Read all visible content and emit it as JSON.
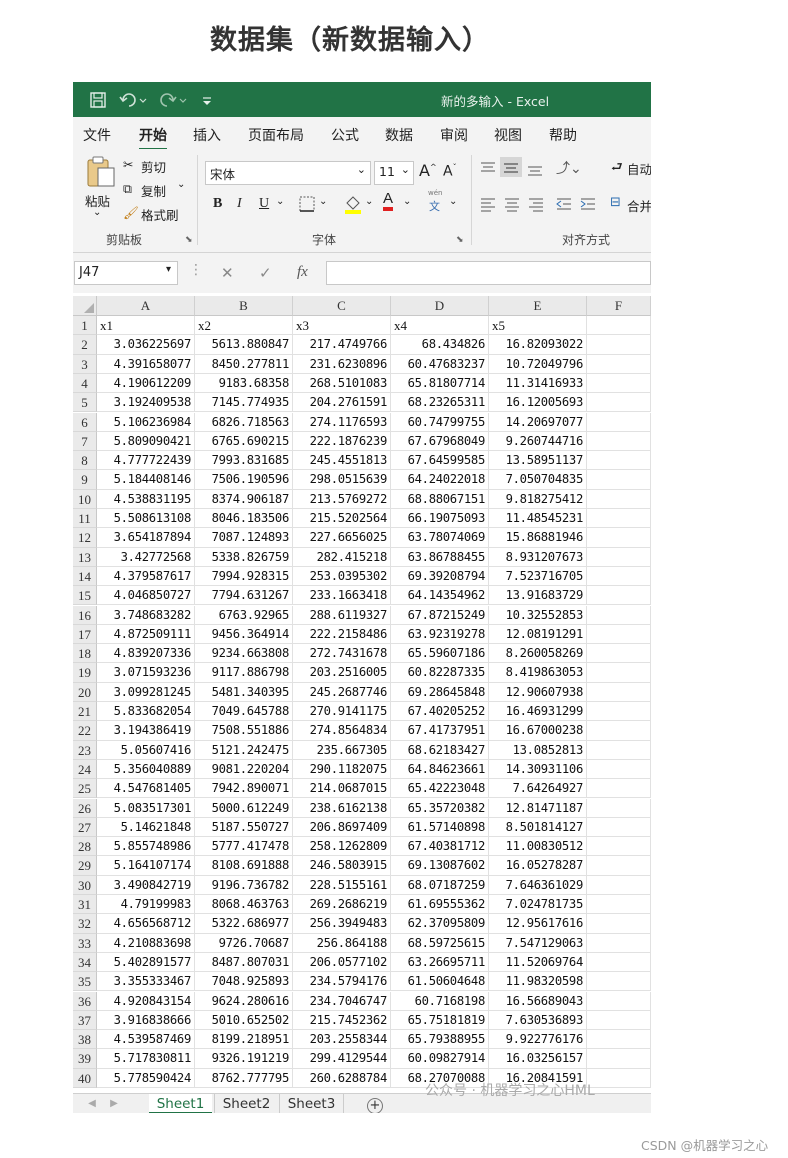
{
  "page_title": "数据集（新数据输入）",
  "window": {
    "title": "新的多输入 - Excel",
    "quick_access_icons": [
      "save-icon",
      "undo-icon",
      "redo-icon",
      "customize-icon"
    ]
  },
  "menu_tabs": [
    "文件",
    "开始",
    "插入",
    "页面布局",
    "公式",
    "数据",
    "审阅",
    "视图",
    "帮助"
  ],
  "ribbon": {
    "paste_label": "粘贴",
    "cut_label": "剪切",
    "copy_label": "复制",
    "format_painter_label": "格式刷",
    "clipboard_group": "剪贴板",
    "font_name": "宋体",
    "font_size": "11",
    "bold": "B",
    "italic": "I",
    "underline": "U",
    "font_color_letter": "A",
    "phonetic_small": "wén",
    "phonetic_big": "文",
    "font_group": "字体",
    "wrap_label": "自动",
    "merge_label": "合并",
    "alignment_group": "对齐方式"
  },
  "formula_bar": {
    "name_box": "J47",
    "fx_label": "fx",
    "formula": ""
  },
  "columns": [
    "A",
    "B",
    "C",
    "D",
    "E",
    "F"
  ],
  "headers": [
    "x1",
    "x2",
    "x3",
    "x4",
    "x5"
  ],
  "rows": [
    [
      "3.036225697",
      "5613.880847",
      "217.4749766",
      "68.434826",
      "16.82093022"
    ],
    [
      "4.391658077",
      "8450.277811",
      "231.6230896",
      "60.47683237",
      "10.72049796"
    ],
    [
      "4.190612209",
      "9183.68358",
      "268.5101083",
      "65.81807714",
      "11.31416933"
    ],
    [
      "3.192409538",
      "7145.774935",
      "204.2761591",
      "68.23265311",
      "16.12005693"
    ],
    [
      "5.106236984",
      "6826.718563",
      "274.1176593",
      "60.74799755",
      "14.20697077"
    ],
    [
      "5.809090421",
      "6765.690215",
      "222.1876239",
      "67.67968049",
      "9.260744716"
    ],
    [
      "4.777722439",
      "7993.831685",
      "245.4551813",
      "67.64599585",
      "13.58951137"
    ],
    [
      "5.184408146",
      "7506.190596",
      "298.0515639",
      "64.24022018",
      "7.050704835"
    ],
    [
      "4.538831195",
      "8374.906187",
      "213.5769272",
      "68.88067151",
      "9.818275412"
    ],
    [
      "5.508613108",
      "8046.183506",
      "215.5202564",
      "66.19075093",
      "11.48545231"
    ],
    [
      "3.654187894",
      "7087.124893",
      "227.6656025",
      "63.78074069",
      "15.86881946"
    ],
    [
      "3.42772568",
      "5338.826759",
      "282.415218",
      "63.86788455",
      "8.931207673"
    ],
    [
      "4.379587617",
      "7994.928315",
      "253.0395302",
      "69.39208794",
      "7.523716705"
    ],
    [
      "4.046850727",
      "7794.631267",
      "233.1663418",
      "64.14354962",
      "13.91683729"
    ],
    [
      "3.748683282",
      "6763.92965",
      "288.6119327",
      "67.87215249",
      "10.32552853"
    ],
    [
      "4.872509111",
      "9456.364914",
      "222.2158486",
      "63.92319278",
      "12.08191291"
    ],
    [
      "4.839207336",
      "9234.663808",
      "272.7431678",
      "65.59607186",
      "8.260058269"
    ],
    [
      "3.071593236",
      "9117.886798",
      "203.2516005",
      "60.82287335",
      "8.419863053"
    ],
    [
      "3.099281245",
      "5481.340395",
      "245.2687746",
      "69.28645848",
      "12.90607938"
    ],
    [
      "5.833682054",
      "7049.645788",
      "270.9141175",
      "67.40205252",
      "16.46931299"
    ],
    [
      "3.194386419",
      "7508.551886",
      "274.8564834",
      "67.41737951",
      "16.67000238"
    ],
    [
      "5.05607416",
      "5121.242475",
      "235.667305",
      "68.62183427",
      "13.0852813"
    ],
    [
      "5.356040889",
      "9081.220204",
      "290.1182075",
      "64.84623661",
      "14.30931106"
    ],
    [
      "4.547681405",
      "7942.890071",
      "214.0687015",
      "65.42223048",
      "7.64264927"
    ],
    [
      "5.083517301",
      "5000.612249",
      "238.6162138",
      "65.35720382",
      "12.81471187"
    ],
    [
      "5.14621848",
      "5187.550727",
      "206.8697409",
      "61.57140898",
      "8.501814127"
    ],
    [
      "5.855748986",
      "5777.417478",
      "258.1262809",
      "67.40381712",
      "11.00830512"
    ],
    [
      "5.164107174",
      "8108.691888",
      "246.5803915",
      "69.13087602",
      "16.05278287"
    ],
    [
      "3.490842719",
      "9196.736782",
      "228.5155161",
      "68.07187259",
      "7.646361029"
    ],
    [
      "4.79199983",
      "8068.463763",
      "269.2686219",
      "61.69555362",
      "7.024781735"
    ],
    [
      "4.656568712",
      "5322.686977",
      "256.3949483",
      "62.37095809",
      "12.95617616"
    ],
    [
      "4.210883698",
      "9726.70687",
      "256.864188",
      "68.59725615",
      "7.547129063"
    ],
    [
      "5.402891577",
      "8487.807031",
      "206.0577102",
      "63.26695711",
      "11.52069764"
    ],
    [
      "3.355333467",
      "7048.925893",
      "234.5794176",
      "61.50604648",
      "11.98320598"
    ],
    [
      "4.920843154",
      "9624.280616",
      "234.7046747",
      "60.7168198",
      "16.56689043"
    ],
    [
      "3.916838666",
      "5010.652502",
      "215.7452362",
      "65.75181819",
      "7.630536893"
    ],
    [
      "4.539587469",
      "8199.218951",
      "203.2558344",
      "65.79388955",
      "9.922776176"
    ],
    [
      "5.717830811",
      "9326.191219",
      "299.4129544",
      "60.09827914",
      "16.03256157"
    ],
    [
      "5.778590424",
      "8762.777795",
      "260.6288784",
      "68.27070088",
      "16.20841591"
    ]
  ],
  "sheets": [
    "Sheet1",
    "Sheet2",
    "Sheet3"
  ],
  "active_sheet": "Sheet1",
  "add_sheet_symbol": "+",
  "watermarks": {
    "wechat": "公众号 · 机器学习之心HML",
    "csdn": "CSDN @机器学习之心"
  },
  "colors": {
    "excel_green": "#217346",
    "ribbon_bg": "#f3f3f3",
    "header_bg": "#eaeaea"
  }
}
